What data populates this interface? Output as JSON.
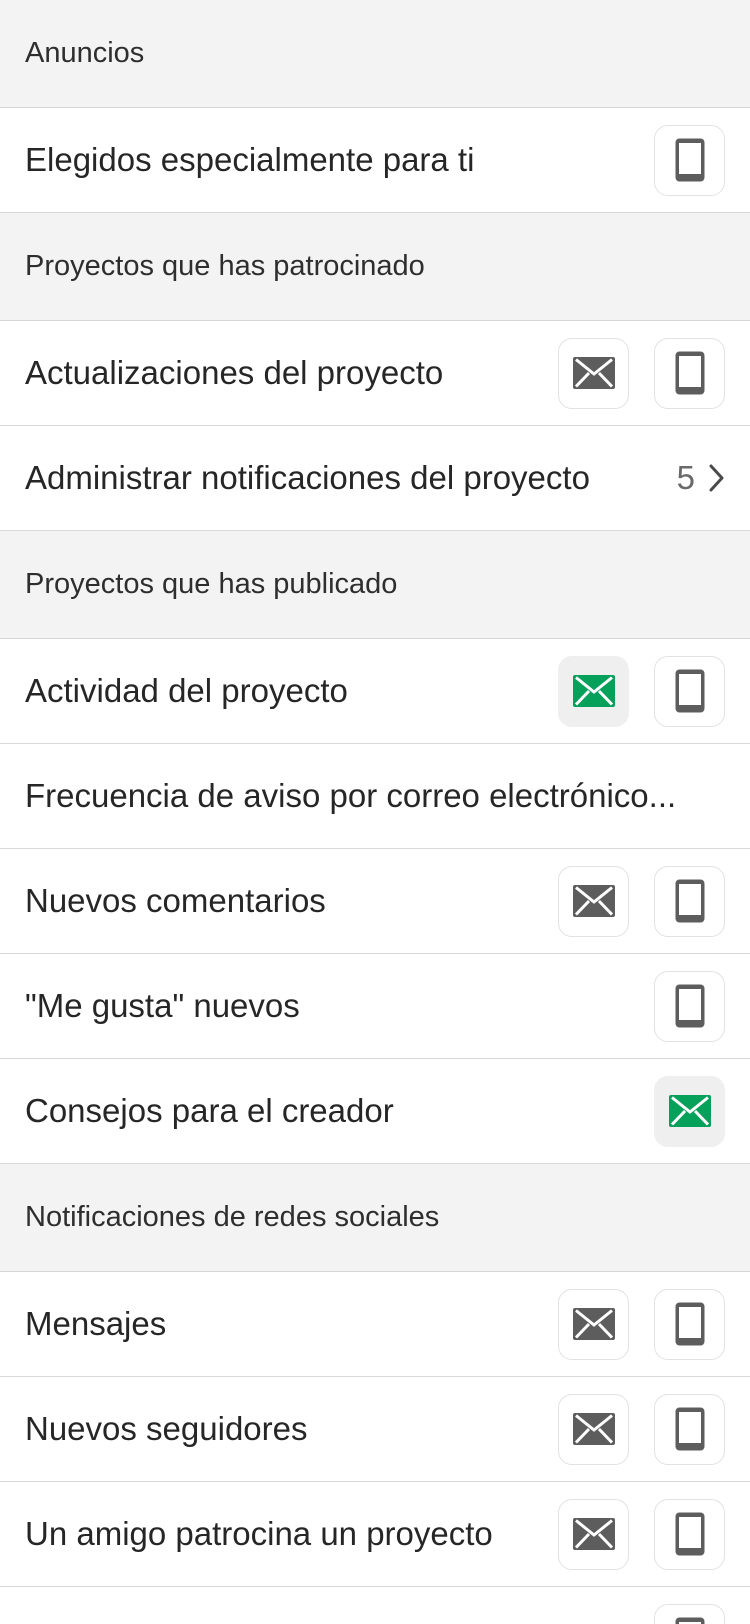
{
  "colors": {
    "accent": "#05a05a",
    "icon_gray": "#5d5d5d",
    "section_bg": "#f3f3f3"
  },
  "sections": {
    "anuncios": "Anuncios",
    "patrocinado": "Proyectos que has patrocinado",
    "publicado": "Proyectos que has publicado",
    "sociales": "Notificaciones de redes sociales"
  },
  "rows": {
    "elegidos": "Elegidos especialmente para ti",
    "actualizaciones": "Actualizaciones del proyecto",
    "administrar": "Administrar notificaciones del proyecto",
    "administrar_count": "5",
    "actividad": "Actividad del proyecto",
    "frecuencia": "Frecuencia de aviso por correo electrónico...",
    "comentarios": "Nuevos comentarios",
    "megusta": "\"Me gusta\" nuevos",
    "consejos": "Consejos para el creador",
    "mensajes": "Mensajes",
    "seguidores": "Nuevos seguidores",
    "amigo": "Un amigo patrocina un proyecto"
  },
  "icons": {
    "email": "envelope-icon",
    "phone": "phone-icon",
    "chevron": "chevron-right-icon"
  }
}
